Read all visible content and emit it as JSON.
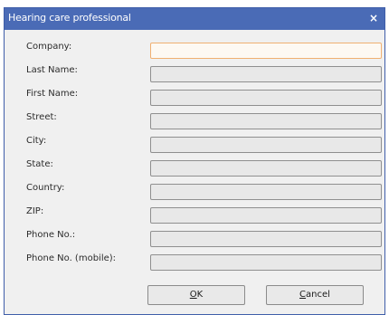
{
  "dialog": {
    "title": "Hearing care professional",
    "close_glyph": "×"
  },
  "form": {
    "fields": [
      {
        "label": "Company:",
        "value": ""
      },
      {
        "label": "Last Name:",
        "value": ""
      },
      {
        "label": "First Name:",
        "value": ""
      },
      {
        "label": "Street:",
        "value": ""
      },
      {
        "label": "City:",
        "value": ""
      },
      {
        "label": "State:",
        "value": ""
      },
      {
        "label": "Country:",
        "value": ""
      },
      {
        "label": "ZIP:",
        "value": ""
      },
      {
        "label": "Phone No.:",
        "value": ""
      },
      {
        "label": "Phone No. (mobile):",
        "value": ""
      }
    ]
  },
  "buttons": {
    "ok_mnemonic": "O",
    "ok_rest": "K",
    "cancel_mnemonic": "C",
    "cancel_rest": "ancel"
  },
  "colors": {
    "titlebar": "#4a6bb6",
    "dialog_bg": "#f0f0f0",
    "focus_border": "#f0b072"
  }
}
